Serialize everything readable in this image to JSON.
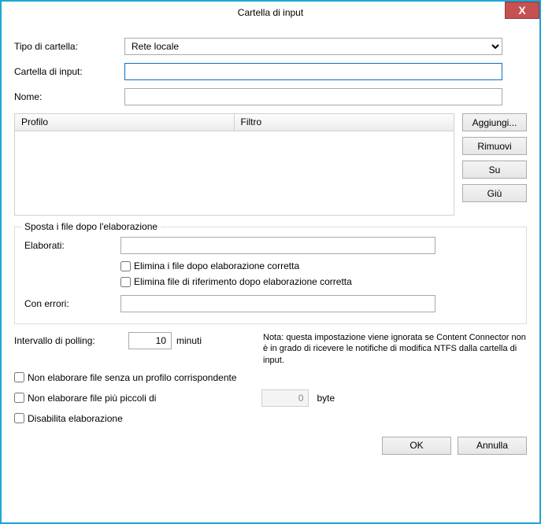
{
  "window": {
    "title": "Cartella di input",
    "close": "X"
  },
  "form": {
    "folderTypeLabel": "Tipo di cartella:",
    "folderTypeValue": "Rete locale",
    "inputFolderLabel": "Cartella di input:",
    "inputFolderValue": "",
    "nameLabel": "Nome:",
    "nameValue": ""
  },
  "table": {
    "col1": "Profilo",
    "col2": "Filtro"
  },
  "buttons": {
    "add": "Aggiungi...",
    "remove": "Rimuovi",
    "up": "Su",
    "down": "Giù"
  },
  "move": {
    "legend": "Sposta i file dopo l'elaborazione",
    "processedLabel": "Elaborati:",
    "processedValue": "",
    "chk1": "Elimina i file dopo elaborazione corretta",
    "chk2": "Elimina file di riferimento dopo elaborazione corretta",
    "errorsLabel": "Con errori:",
    "errorsValue": ""
  },
  "polling": {
    "label": "Intervallo di polling:",
    "value": "10",
    "unit": "minuti",
    "note": "Nota: questa impostazione viene ignorata se Content Connector non è in grado di ricevere le notifiche di modifica NTFS dalla cartella di input."
  },
  "options": {
    "noProfile": "Non elaborare file senza un profilo corrispondente",
    "noSmaller": "Non elaborare file più piccoli di",
    "sizeValue": "0",
    "sizeUnit": "byte",
    "disable": "Disabilita elaborazione"
  },
  "dialog": {
    "ok": "OK",
    "cancel": "Annulla"
  }
}
